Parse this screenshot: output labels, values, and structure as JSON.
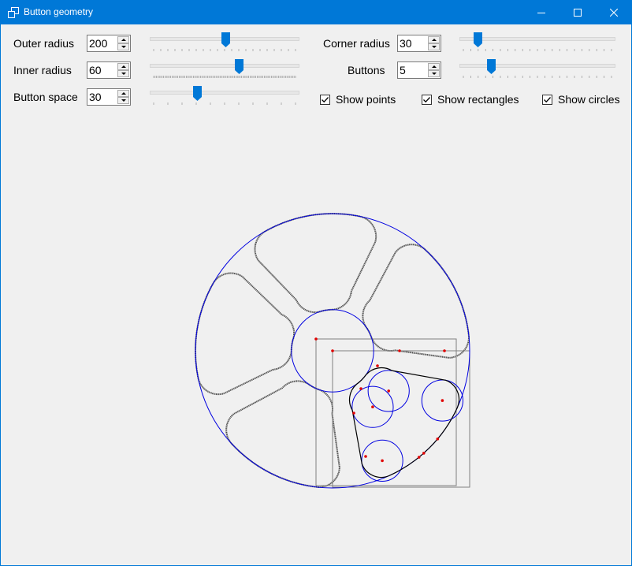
{
  "window": {
    "title": "Button geometry"
  },
  "controls": {
    "outer_radius": {
      "label": "Outer radius",
      "value": "200",
      "slider_fraction": 0.51
    },
    "inner_radius": {
      "label": "Inner radius",
      "value": "60",
      "slider_fraction": 0.6
    },
    "button_space": {
      "label": "Button space",
      "value": "30",
      "slider_fraction": 0.31
    },
    "corner_radius": {
      "label": "Corner radius",
      "value": "30",
      "slider_fraction": 0.1
    },
    "buttons": {
      "label": "Buttons",
      "value": "5",
      "slider_fraction": 0.19
    }
  },
  "checkboxes": {
    "show_points": {
      "label": "Show points",
      "checked": true
    },
    "show_rectangles": {
      "label": "Show rectangles",
      "checked": true
    },
    "show_circles": {
      "label": "Show circles",
      "checked": true
    }
  },
  "colors": {
    "accent": "#0078d7",
    "circle": "#0000e0",
    "point": "#e00000",
    "outline": "#444444",
    "rect": "#808080"
  }
}
